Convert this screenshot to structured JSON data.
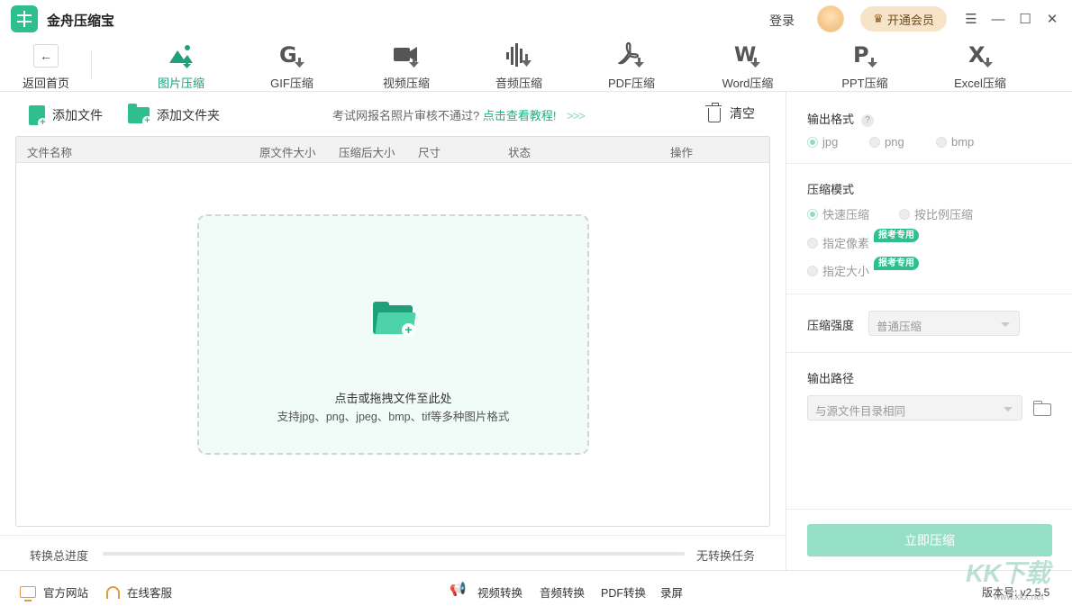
{
  "app": {
    "title": "金舟压缩宝"
  },
  "titlebar": {
    "login": "登录",
    "vip_label": "开通会员",
    "menu_icon": "menu-icon",
    "minimize_icon": "minimize-icon",
    "maximize_icon": "maximize-icon",
    "close_icon": "close-icon"
  },
  "toolbar": {
    "back_label": "返回首页",
    "tools": [
      {
        "label": "图片压缩",
        "glyph": "▲",
        "active": true
      },
      {
        "label": "GIF压缩",
        "glyph": "G",
        "active": false
      },
      {
        "label": "视频压缩",
        "glyph": "■",
        "active": false
      },
      {
        "label": "音频压缩",
        "glyph": "|||",
        "active": false
      },
      {
        "label": "PDF压缩",
        "glyph": "ℊ",
        "active": false
      },
      {
        "label": "Word压缩",
        "glyph": "W",
        "active": false
      },
      {
        "label": "PPT压缩",
        "glyph": "P",
        "active": false
      },
      {
        "label": "Excel压缩",
        "glyph": "X",
        "active": false
      }
    ]
  },
  "actions": {
    "add_file": "添加文件",
    "add_folder": "添加文件夹",
    "tip_text": "考试网报名照片审核不通过?",
    "tip_link": "点击查看教程!",
    "tip_arrows": ">>>",
    "clear": "清空"
  },
  "table": {
    "columns": [
      "文件名称",
      "原文件大小",
      "压缩后大小",
      "尺寸",
      "状态",
      "操作"
    ]
  },
  "dropzone": {
    "main": "点击或拖拽文件至此处",
    "sub": "支持jpg、png、jpeg、bmp、tif等多种图片格式"
  },
  "progress": {
    "label": "转换总进度",
    "value": 0,
    "status": "无转换任务"
  },
  "settings": {
    "output_format": {
      "title": "输出格式",
      "help": "?",
      "options": [
        "jpg",
        "png",
        "bmp"
      ],
      "selected": "jpg"
    },
    "compress_mode": {
      "title": "压缩模式",
      "options": [
        "快速压缩",
        "按比例压缩",
        "指定像素",
        "指定大小"
      ],
      "selected": "快速压缩",
      "tag": "报考专用"
    },
    "strength": {
      "title": "压缩强度",
      "value": "普通压缩"
    },
    "output_path": {
      "title": "输出路径",
      "value": "与源文件目录相同"
    },
    "submit": "立即压缩"
  },
  "footer": {
    "website": "官方网站",
    "support": "在线客服",
    "links": [
      "视频转换",
      "音频转换",
      "PDF转换",
      "录屏"
    ],
    "version": "版本号: v2.5.5"
  },
  "watermark": {
    "text": "KK下载",
    "url": "www.kkx.net"
  },
  "colors": {
    "accent": "#2fbf8f",
    "accent_dark": "#1f9f7a",
    "link": "#22b07d",
    "button_disabled": "#95e0c7",
    "vip_bg": "#f7e4c8"
  }
}
